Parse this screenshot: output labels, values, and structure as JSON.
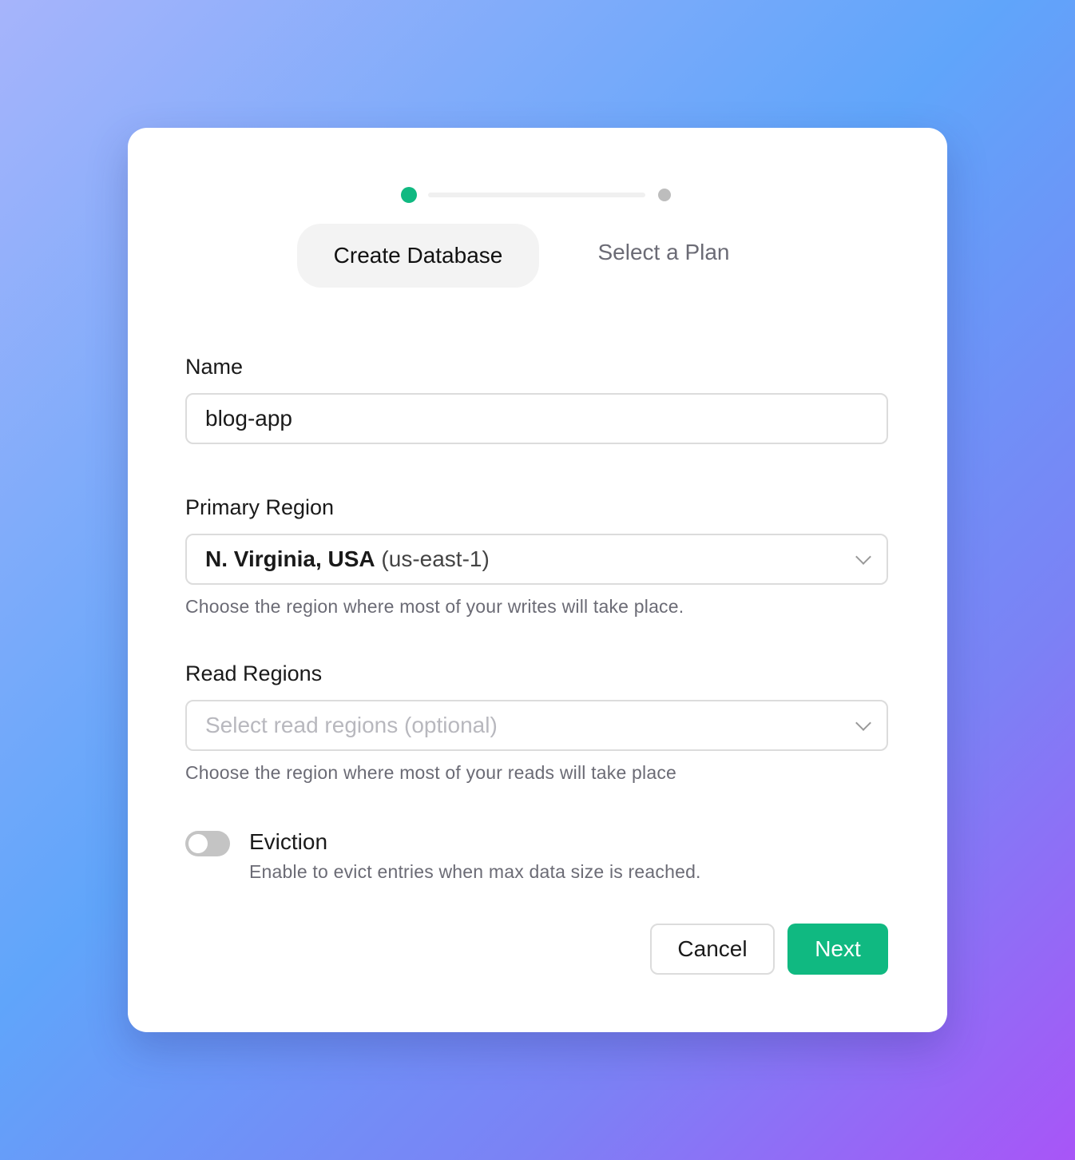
{
  "steps": [
    {
      "label": "Create Database",
      "active": true
    },
    {
      "label": "Select a Plan",
      "active": false
    }
  ],
  "colors": {
    "accent": "#10b981",
    "inactive_dot": "#bdbdbd"
  },
  "form": {
    "name": {
      "label": "Name",
      "value": "blog-app"
    },
    "primary_region": {
      "label": "Primary Region",
      "value_bold": "N. Virginia, USA",
      "value_code": "(us-east-1)",
      "help": "Choose the region where most of your writes will take place."
    },
    "read_regions": {
      "label": "Read Regions",
      "placeholder": "Select read regions (optional)",
      "help": "Choose the region where most of your reads will take place"
    },
    "eviction": {
      "label": "Eviction",
      "help": "Enable to evict entries when max data size is reached.",
      "enabled": false
    }
  },
  "actions": {
    "cancel": "Cancel",
    "next": "Next"
  }
}
